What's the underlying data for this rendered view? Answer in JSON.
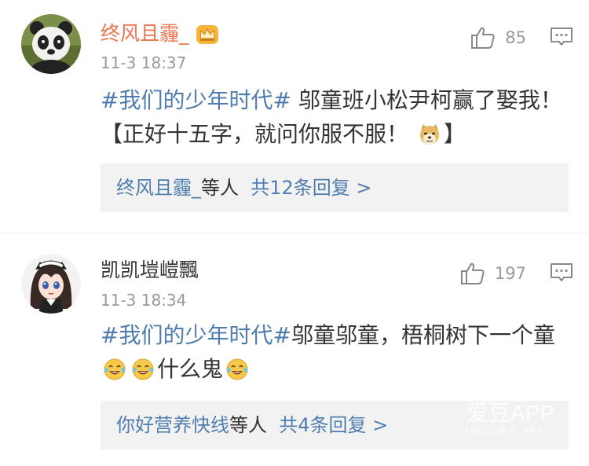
{
  "comments": [
    {
      "username": "终风且霾_",
      "avatar_icon": "panda-avatar",
      "badge_icon": "vip-crown-icon",
      "time": "11-3 18:37",
      "likes": "85",
      "text": {
        "tag": "#我们的少年时代#",
        "body": " 邬童班小松尹柯赢了娶我！【正好十五字，就问你服不服！",
        "emoji": "doge-emoji",
        "end": "】"
      },
      "replies": {
        "users": "终风且霾_",
        "suffix": "等人",
        "count_text": "共12条回复 >"
      }
    },
    {
      "username": "凯凯塏嵦飄",
      "avatar_icon": "anime-girl-avatar",
      "time": "11-3 18:34",
      "likes": "197",
      "text": {
        "tag": "#我们的少年时代#",
        "body1": "邬童邬童，梧桐树下一个童",
        "emoji1": "laugh-cry-emoji",
        "emoji2": "laugh-cry-emoji",
        "body2": "什么鬼",
        "emoji3": "laugh-cry-emoji"
      },
      "replies": {
        "users": "你好营养快线",
        "suffix": "等人",
        "count_text": "共4条回复 >"
      }
    }
  ],
  "watermark": {
    "main": "爱豆APP",
    "sub": "iDOL  爱豆 APP"
  },
  "colors": {
    "link": "#507daf",
    "vip_name": "#eb7350",
    "meta": "#999999",
    "reply_bg": "#f2f2f2"
  }
}
